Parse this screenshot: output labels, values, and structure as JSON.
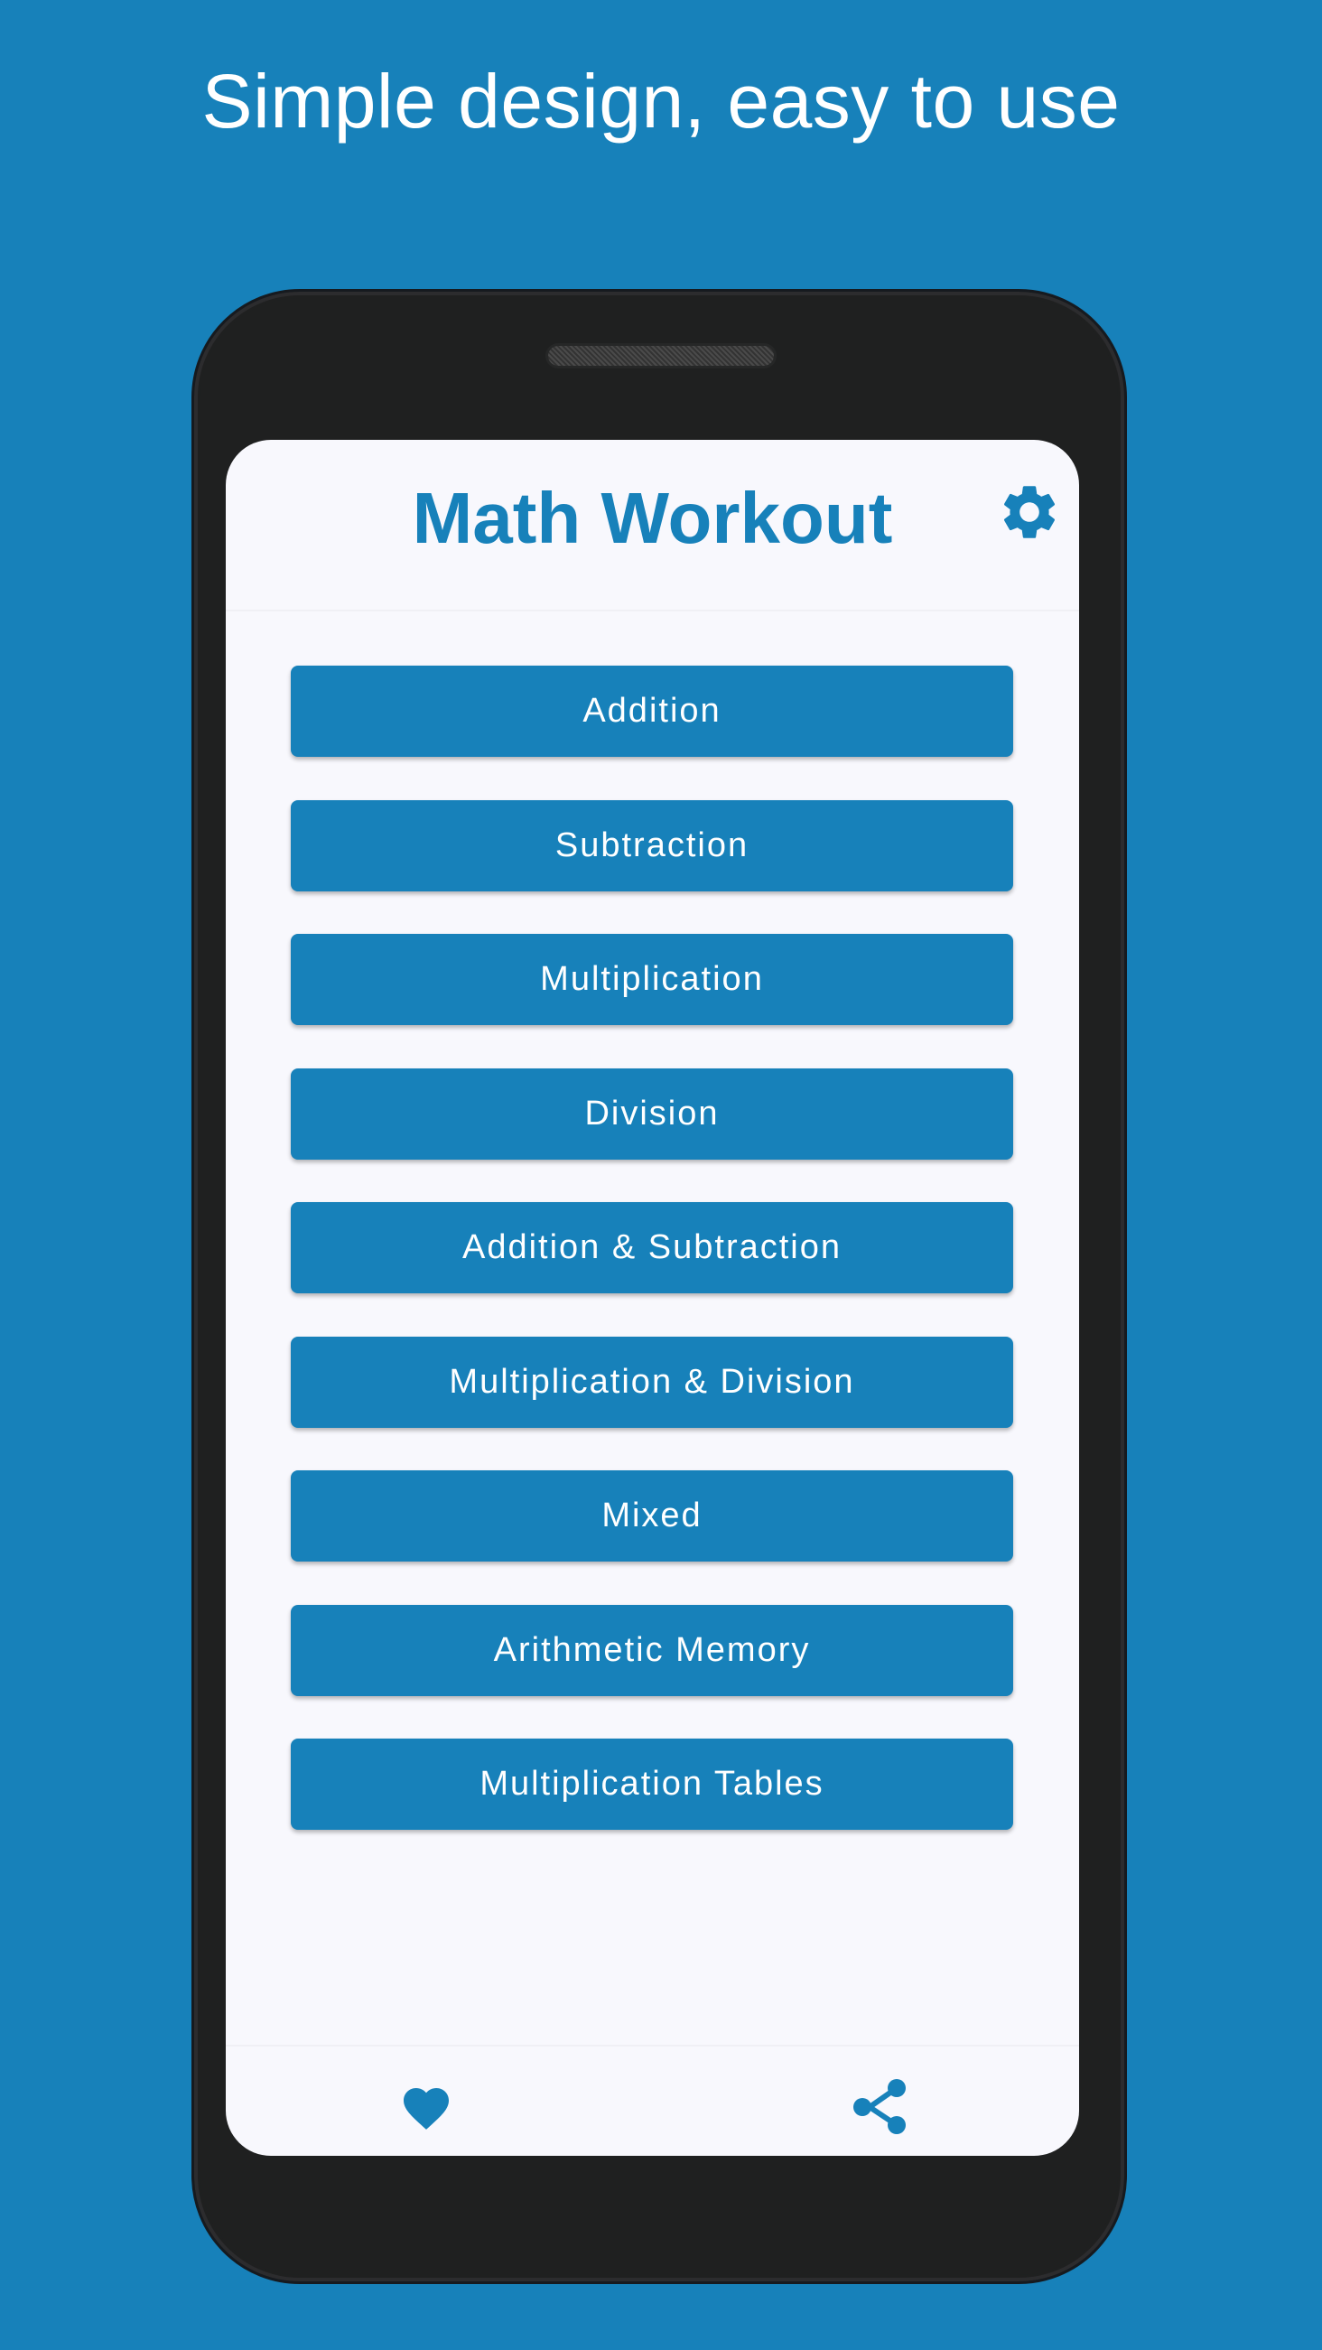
{
  "promo": {
    "heading": "Simple design, easy to use"
  },
  "app": {
    "title": "Math Workout",
    "settings_icon": "gear-icon"
  },
  "menu": {
    "items": [
      {
        "label": "Addition"
      },
      {
        "label": "Subtraction"
      },
      {
        "label": "Multiplication"
      },
      {
        "label": "Division"
      },
      {
        "label": "Addition & Subtraction"
      },
      {
        "label": "Multiplication & Division"
      },
      {
        "label": "Mixed"
      },
      {
        "label": "Arithmetic Memory"
      },
      {
        "label": "Multiplication Tables"
      }
    ]
  },
  "bottom_nav": {
    "favorite_icon": "heart-icon",
    "share_icon": "share-icon"
  },
  "colors": {
    "background": "#1781ba",
    "accent": "#1781ba",
    "button_text": "#ffffff",
    "screen_background": "#f8f8fd",
    "phone_body": "#1f2020"
  }
}
